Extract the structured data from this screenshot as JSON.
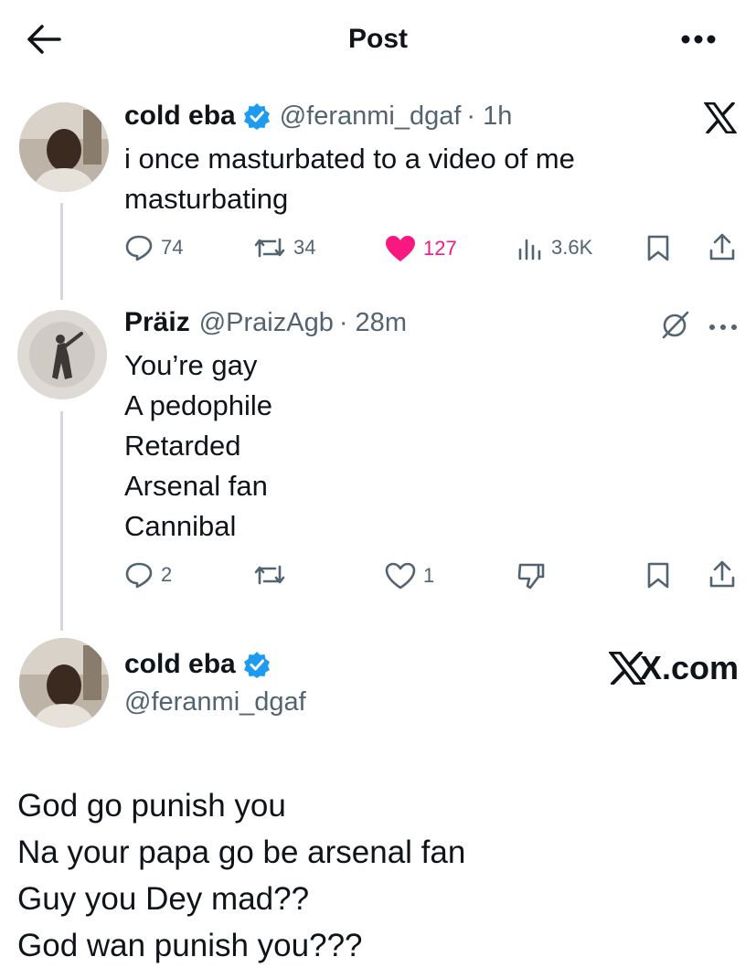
{
  "header": {
    "title": "Post",
    "back_icon": "arrow-left-icon",
    "more_icon": "more-horizontal-icon"
  },
  "posts": [
    {
      "name": "cold eba",
      "verified": true,
      "handle": "@feranmi_dgaf",
      "time": "· 1h",
      "text_lines": [
        "i once masturbated to a video of me",
        "masturbating"
      ],
      "actions": {
        "replies": "74",
        "reposts": "34",
        "likes": "127",
        "views": "3.6K"
      },
      "liked": true
    },
    {
      "name": "Präiz",
      "handle": "@PraizAgb",
      "time": "· 28m",
      "text_lines": [
        "You’re gay",
        "A pedophile",
        "Retarded",
        "Arsenal fan",
        "Cannibal"
      ],
      "actions": {
        "replies": "2",
        "reposts": "",
        "likes": "1"
      }
    }
  ],
  "reply_composer": {
    "name": "cold eba",
    "handle": "@feranmi_dgaf",
    "brand": "X.com",
    "text_lines": [
      "God go punish you",
      "Na your papa go be arsenal fan",
      "Guy you Dey mad??",
      "God wan punish you???"
    ]
  },
  "colors": {
    "like": "#f91880",
    "verified": "#1d9bf0",
    "icon": "#536471",
    "text": "#0f1419"
  }
}
